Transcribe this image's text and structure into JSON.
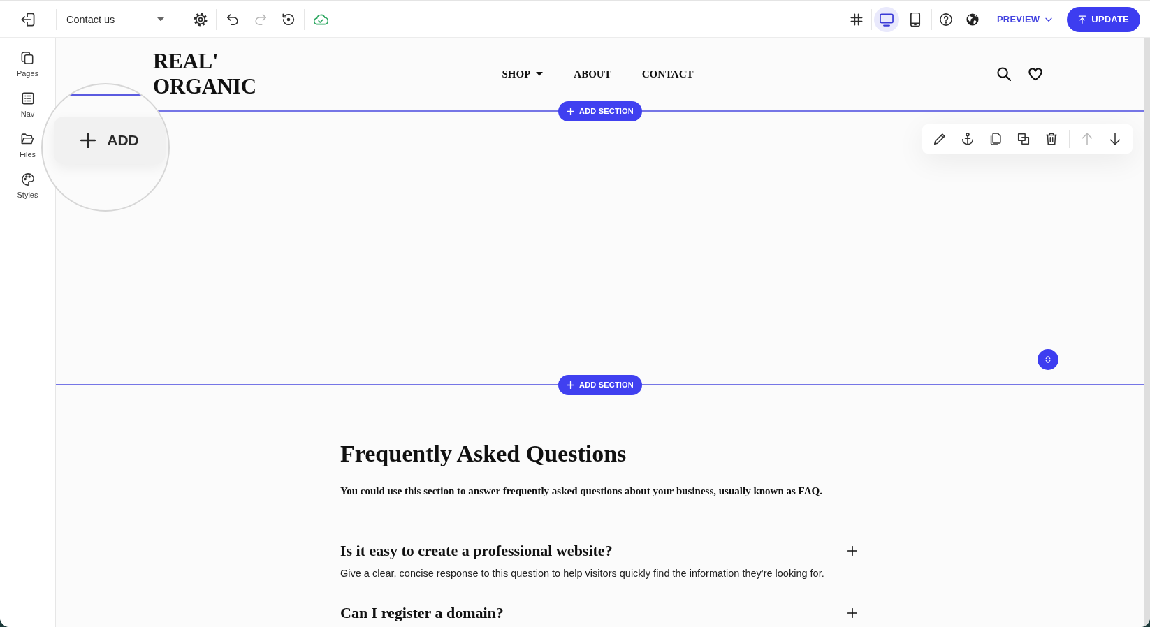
{
  "topbar": {
    "page_select": {
      "value": "Contact us"
    },
    "history_tools": [
      {
        "kind": "undo",
        "disabled": false
      },
      {
        "kind": "redo",
        "disabled": true
      },
      {
        "kind": "history",
        "disabled": false
      }
    ],
    "save_status": {
      "saved": true
    },
    "view_modes": [
      {
        "kind": "desktop",
        "selected": true
      },
      {
        "kind": "mobile",
        "selected": false
      }
    ],
    "preview": {
      "label": "PREVIEW"
    },
    "update": {
      "label": "UPDATE"
    }
  },
  "sidebar": {
    "items": [
      {
        "kind": "pages",
        "label": "Pages"
      },
      {
        "kind": "nav",
        "label": "Nav"
      },
      {
        "kind": "files",
        "label": "Files"
      },
      {
        "kind": "styles",
        "label": "Styles"
      }
    ]
  },
  "site_header": {
    "logo": "REAL' ORGANIC",
    "nav": [
      {
        "label": "SHOP",
        "has_menu": true
      },
      {
        "label": "ABOUT",
        "has_menu": false
      },
      {
        "label": "CONTACT",
        "has_menu": false
      }
    ]
  },
  "add_section_buttons": [
    {
      "label": "ADD SECTION"
    },
    {
      "label": "ADD SECTION"
    }
  ],
  "zoom_lens": {
    "button": {
      "label": "ADD"
    }
  },
  "section_toolbar": {
    "actions": [
      {
        "kind": "edit"
      },
      {
        "kind": "anchor"
      },
      {
        "kind": "copy"
      },
      {
        "kind": "duplicate"
      },
      {
        "kind": "delete"
      }
    ],
    "move": [
      {
        "kind": "move-up",
        "disabled": true
      },
      {
        "kind": "move-down",
        "disabled": false
      }
    ]
  },
  "faq": {
    "title": "Frequently Asked Questions",
    "intro": "You could use this section to answer frequently asked questions about your business, usually known as FAQ.",
    "items": [
      {
        "question": "Is it easy to create a professional website?",
        "answer": "Give a clear, concise response to this question to help visitors quickly find the information they're looking for."
      },
      {
        "question": "Can I register a domain?"
      }
    ]
  }
}
